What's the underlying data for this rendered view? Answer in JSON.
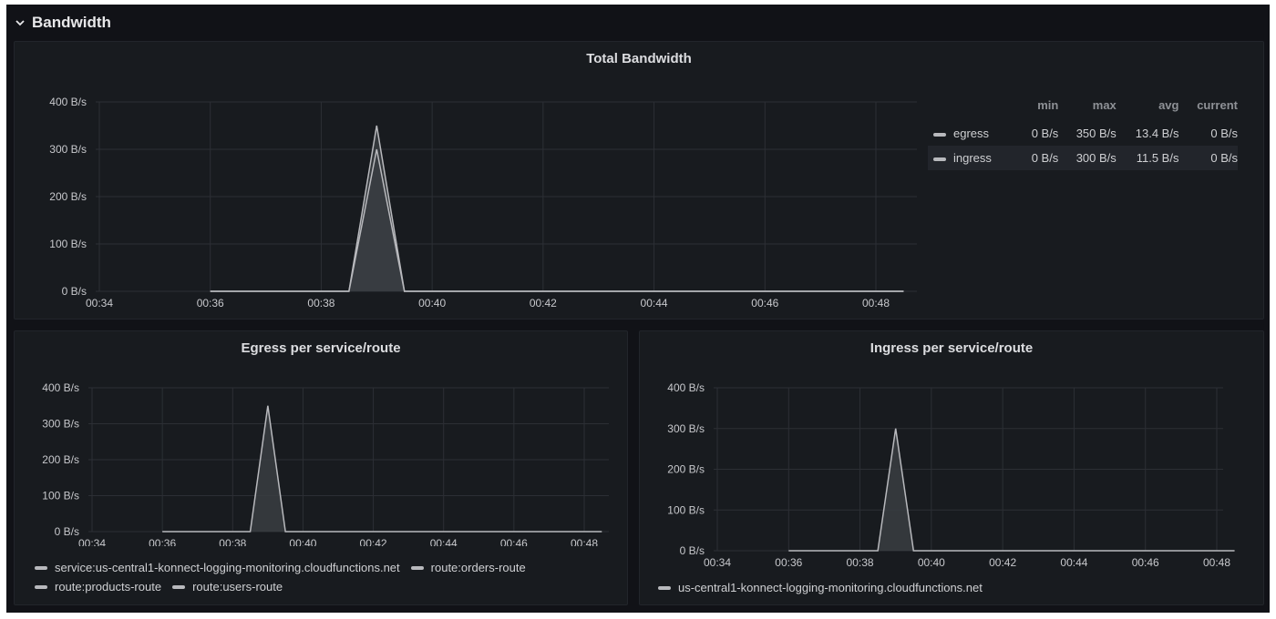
{
  "row": {
    "title": "Bandwidth",
    "chevron_icon": "chevron-down-icon"
  },
  "panels": {
    "total": {
      "title": "Total Bandwidth",
      "legend": {
        "headers": [
          "min",
          "max",
          "avg",
          "current"
        ],
        "rows": [
          {
            "name": "egress",
            "min": "0 B/s",
            "max": "350 B/s",
            "avg": "13.4 B/s",
            "current": "0 B/s"
          },
          {
            "name": "ingress",
            "min": "0 B/s",
            "max": "300 B/s",
            "avg": "11.5 B/s",
            "current": "0 B/s"
          }
        ]
      }
    },
    "egress": {
      "title": "Egress per service/route",
      "legend": [
        "service:us-central1-konnect-logging-monitoring.cloudfunctions.net",
        "route:orders-route",
        "route:products-route",
        "route:users-route"
      ]
    },
    "ingress": {
      "title": "Ingress per service/route",
      "legend": [
        "us-central1-konnect-logging-monitoring.cloudfunctions.net"
      ]
    }
  },
  "colors": {
    "background": "#111217",
    "panel": "#181b1f",
    "grid": "#2c2f35",
    "series": "#b8b9bd"
  },
  "chart_data": [
    {
      "type": "area",
      "title": "Total Bandwidth",
      "x_ticks": [
        "00:34",
        "00:36",
        "00:38",
        "00:40",
        "00:42",
        "00:44",
        "00:46",
        "00:48"
      ],
      "y_ticks": [
        "0 B/s",
        "100 B/s",
        "200 B/s",
        "300 B/s",
        "400 B/s"
      ],
      "ylim": [
        0,
        400
      ],
      "series": [
        {
          "name": "egress",
          "points": [
            [
              "00:36",
              0
            ],
            [
              "00:38:30",
              0
            ],
            [
              "00:39",
              350
            ],
            [
              "00:39:30",
              0
            ],
            [
              "00:48:30",
              0
            ]
          ]
        },
        {
          "name": "ingress",
          "points": [
            [
              "00:36",
              0
            ],
            [
              "00:38:30",
              0
            ],
            [
              "00:39",
              300
            ],
            [
              "00:39:30",
              0
            ],
            [
              "00:48:30",
              0
            ]
          ]
        }
      ],
      "grid": true,
      "legend": "right"
    },
    {
      "type": "area",
      "title": "Egress per service/route",
      "x_ticks": [
        "00:34",
        "00:36",
        "00:38",
        "00:40",
        "00:42",
        "00:44",
        "00:46",
        "00:48"
      ],
      "y_ticks": [
        "0 B/s",
        "100 B/s",
        "200 B/s",
        "300 B/s",
        "400 B/s"
      ],
      "ylim": [
        0,
        400
      ],
      "series": [
        {
          "name": "service:us-central1-konnect-logging-monitoring.cloudfunctions.net",
          "points": [
            [
              "00:36",
              0
            ],
            [
              "00:38:30",
              0
            ],
            [
              "00:39",
              350
            ],
            [
              "00:39:30",
              0
            ],
            [
              "00:48:30",
              0
            ]
          ]
        }
      ],
      "grid": true,
      "legend": "bottom"
    },
    {
      "type": "area",
      "title": "Ingress per service/route",
      "x_ticks": [
        "00:34",
        "00:36",
        "00:38",
        "00:40",
        "00:42",
        "00:44",
        "00:46",
        "00:48"
      ],
      "y_ticks": [
        "0 B/s",
        "100 B/s",
        "200 B/s",
        "300 B/s",
        "400 B/s"
      ],
      "ylim": [
        0,
        400
      ],
      "series": [
        {
          "name": "us-central1-konnect-logging-monitoring.cloudfunctions.net",
          "points": [
            [
              "00:36",
              0
            ],
            [
              "00:38:30",
              0
            ],
            [
              "00:39",
              300
            ],
            [
              "00:39:30",
              0
            ],
            [
              "00:48:30",
              0
            ]
          ]
        }
      ],
      "grid": true,
      "legend": "bottom"
    }
  ]
}
